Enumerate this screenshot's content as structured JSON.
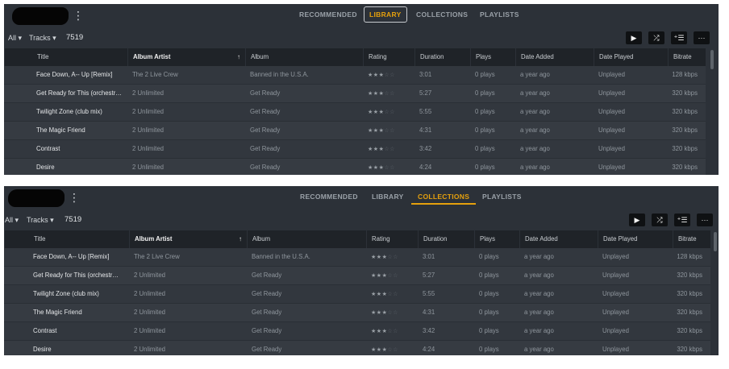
{
  "panels": [
    {
      "nav": {
        "tabs": [
          "RECOMMENDED",
          "LIBRARY",
          "COLLECTIONS",
          "PLAYLISTS"
        ],
        "active": "LIBRARY"
      },
      "toolbar": {
        "all_label": "All",
        "tracks_label": "Tracks",
        "count": "7519"
      },
      "columns": [
        "Title",
        "Album Artist",
        "Album",
        "Rating",
        "Duration",
        "Plays",
        "Date Added",
        "Date Played",
        "Bitrate"
      ],
      "rows": [
        {
          "title": "Face Down, A-- Up [Remix]",
          "artist": "The 2 Live Crew",
          "album": "Banned in the U.S.A.",
          "rating": 3,
          "duration": "3:01",
          "plays": "0 plays",
          "added": "a year ago",
          "played": "Unplayed",
          "bitrate": "128 kbps"
        },
        {
          "title": "Get Ready for This (orchestr…",
          "artist": "2 Unlimited",
          "album": "Get Ready",
          "rating": 3,
          "duration": "5:27",
          "plays": "0 plays",
          "added": "a year ago",
          "played": "Unplayed",
          "bitrate": "320 kbps"
        },
        {
          "title": "Twilight Zone (club mix)",
          "artist": "2 Unlimited",
          "album": "Get Ready",
          "rating": 3,
          "duration": "5:55",
          "plays": "0 plays",
          "added": "a year ago",
          "played": "Unplayed",
          "bitrate": "320 kbps"
        },
        {
          "title": "The Magic Friend",
          "artist": "2 Unlimited",
          "album": "Get Ready",
          "rating": 3,
          "duration": "4:31",
          "plays": "0 plays",
          "added": "a year ago",
          "played": "Unplayed",
          "bitrate": "320 kbps"
        },
        {
          "title": "Contrast",
          "artist": "2 Unlimited",
          "album": "Get Ready",
          "rating": 3,
          "duration": "3:42",
          "plays": "0 plays",
          "added": "a year ago",
          "played": "Unplayed",
          "bitrate": "320 kbps"
        },
        {
          "title": "Desire",
          "artist": "2 Unlimited",
          "album": "Get Ready",
          "rating": 3,
          "duration": "4:24",
          "plays": "0 plays",
          "added": "a year ago",
          "played": "Unplayed",
          "bitrate": "320 kbps"
        }
      ]
    },
    {
      "nav": {
        "tabs": [
          "RECOMMENDED",
          "LIBRARY",
          "COLLECTIONS",
          "PLAYLISTS"
        ],
        "active": "COLLECTIONS"
      },
      "toolbar": {
        "all_label": "All",
        "tracks_label": "Tracks",
        "count": "7519"
      },
      "columns": [
        "Title",
        "Album Artist",
        "Album",
        "Rating",
        "Duration",
        "Plays",
        "Date Added",
        "Date Played",
        "Bitrate"
      ],
      "rows": [
        {
          "title": "Face Down, A-- Up [Remix]",
          "artist": "The 2 Live Crew",
          "album": "Banned in the U.S.A.",
          "rating": 3,
          "duration": "3:01",
          "plays": "0 plays",
          "added": "a year ago",
          "played": "Unplayed",
          "bitrate": "128 kbps"
        },
        {
          "title": "Get Ready for This (orchestr…",
          "artist": "2 Unlimited",
          "album": "Get Ready",
          "rating": 3,
          "duration": "5:27",
          "plays": "0 plays",
          "added": "a year ago",
          "played": "Unplayed",
          "bitrate": "320 kbps"
        },
        {
          "title": "Twilight Zone (club mix)",
          "artist": "2 Unlimited",
          "album": "Get Ready",
          "rating": 3,
          "duration": "5:55",
          "plays": "0 plays",
          "added": "a year ago",
          "played": "Unplayed",
          "bitrate": "320 kbps"
        },
        {
          "title": "The Magic Friend",
          "artist": "2 Unlimited",
          "album": "Get Ready",
          "rating": 3,
          "duration": "4:31",
          "plays": "0 plays",
          "added": "a year ago",
          "played": "Unplayed",
          "bitrate": "320 kbps"
        },
        {
          "title": "Contrast",
          "artist": "2 Unlimited",
          "album": "Get Ready",
          "rating": 3,
          "duration": "3:42",
          "plays": "0 plays",
          "added": "a year ago",
          "played": "Unplayed",
          "bitrate": "320 kbps"
        },
        {
          "title": "Desire",
          "artist": "2 Unlimited",
          "album": "Get Ready",
          "rating": 3,
          "duration": "4:24",
          "plays": "0 plays",
          "added": "a year ago",
          "played": "Unplayed",
          "bitrate": "320 kbps"
        }
      ]
    }
  ],
  "icons": {
    "more_vertical": "more-vertical-icon",
    "play": "play-icon",
    "shuffle": "shuffle-icon",
    "add_to_queue": "add-to-queue-icon",
    "more": "more-horizontal-icon",
    "sort_ascending": "sort-ascending-icon"
  },
  "colors": {
    "accent": "#e5a00d",
    "panel_bg": "#2c3138",
    "header_bg": "#1f2328"
  }
}
